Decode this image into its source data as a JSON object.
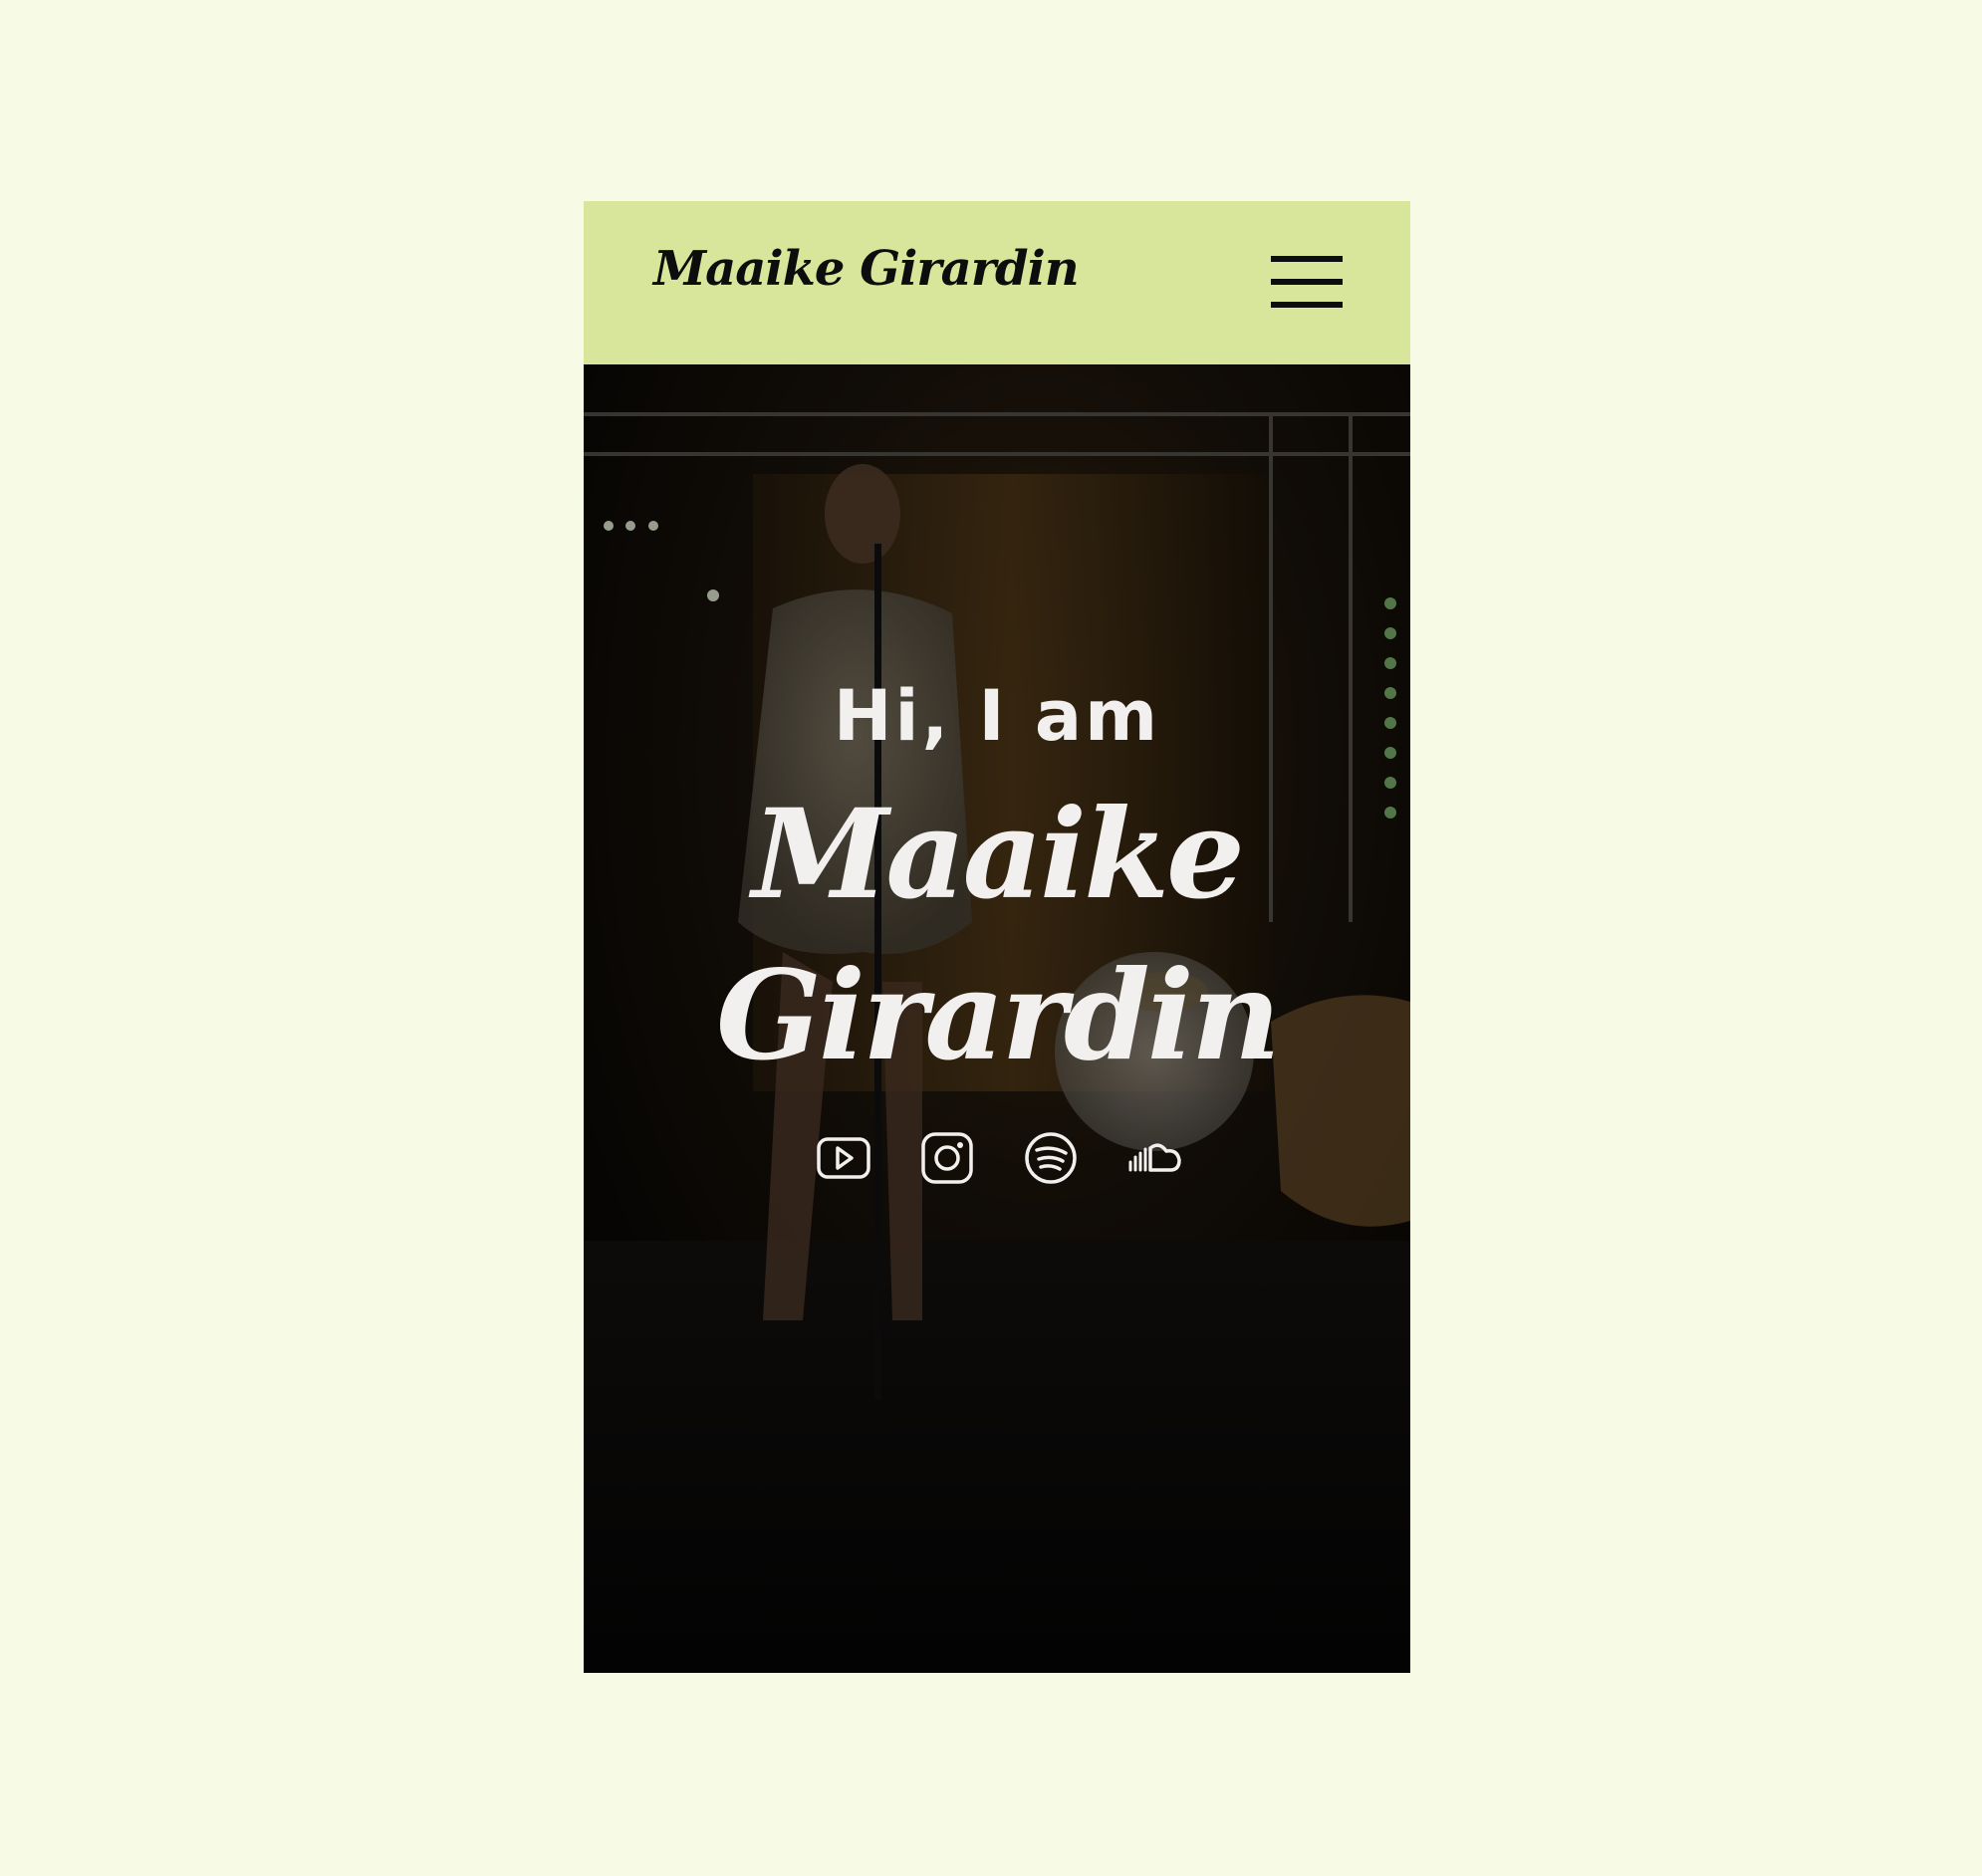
{
  "header": {
    "logo": "Maaike Girardin",
    "menu_icon": "hamburger-menu-icon",
    "background": "#d8e69c"
  },
  "hero": {
    "greeting": "Hi, I am",
    "name_first": "Maaike",
    "name_last": "Girardin",
    "social_icons": [
      "youtube-icon",
      "instagram-icon",
      "spotify-icon",
      "soundcloud-icon"
    ]
  },
  "colors": {
    "page_background": "#f7fbe6",
    "hero_text": "#f2f0ee"
  }
}
